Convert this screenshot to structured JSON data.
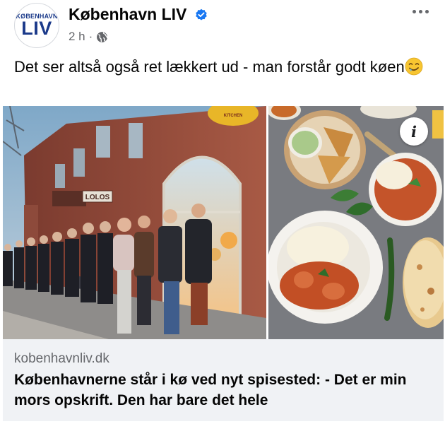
{
  "header": {
    "avatar_top": "KØBENHAVN",
    "avatar_main": "LIV",
    "page_name": "København LIV",
    "time": "2 h",
    "separator": "·",
    "verified_color": "#1877f2"
  },
  "post": {
    "text": "Det ser altså også ret lækkert ud - man forstår godt køen",
    "emoji": "drooling-face-emoji"
  },
  "images": {
    "left_sign": "LOLOS",
    "left_badge": "KITCHEN",
    "info_label": "i"
  },
  "link_preview": {
    "domain": "kobenhavnliv.dk",
    "title": "Københavnerne står i kø ved nyt spisested: - Det er min mors opskrift. Den har bare det hele"
  }
}
